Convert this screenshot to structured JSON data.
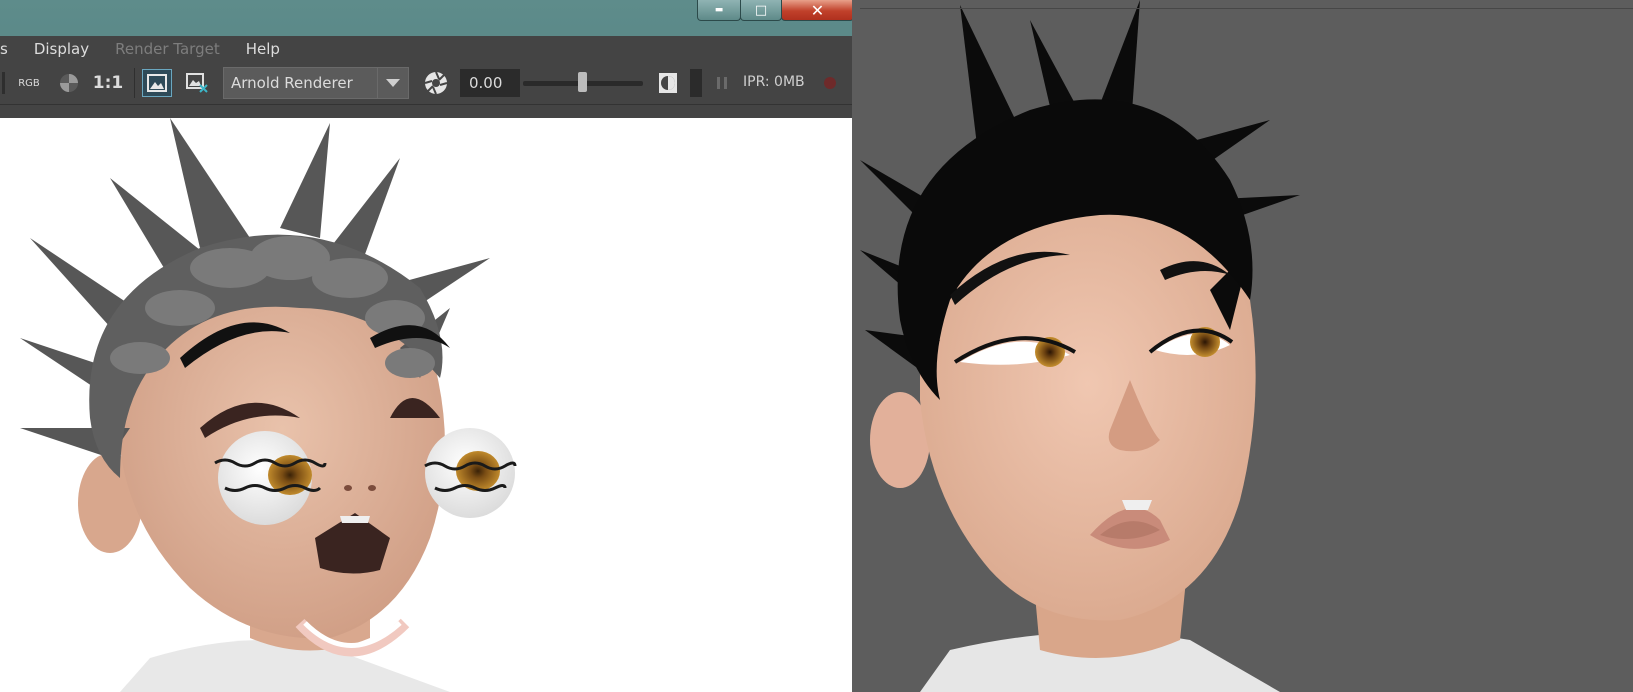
{
  "render_view": {
    "menu": [
      "s",
      "Display",
      "Render Target",
      "Help"
    ],
    "menu_disabled": [
      "Render Target"
    ],
    "toolbar": {
      "channel_label": "RGB",
      "ratio_label": "1:1",
      "renderer": "Arnold Renderer",
      "exposure_value": "0.00",
      "ipr_status": "IPR: 0MB"
    }
  },
  "window_controls": {
    "minimize_glyph": "▬",
    "maximize_glyph": "□",
    "close_glyph": "✕"
  },
  "colors": {
    "render_background": "#ffffff",
    "viewport_background": "#5d5d5d",
    "skin": "#e2b39a",
    "hair_render": "#5a5a5a",
    "hair_viewport": "#0a0a0a",
    "iris": "#b07820"
  }
}
